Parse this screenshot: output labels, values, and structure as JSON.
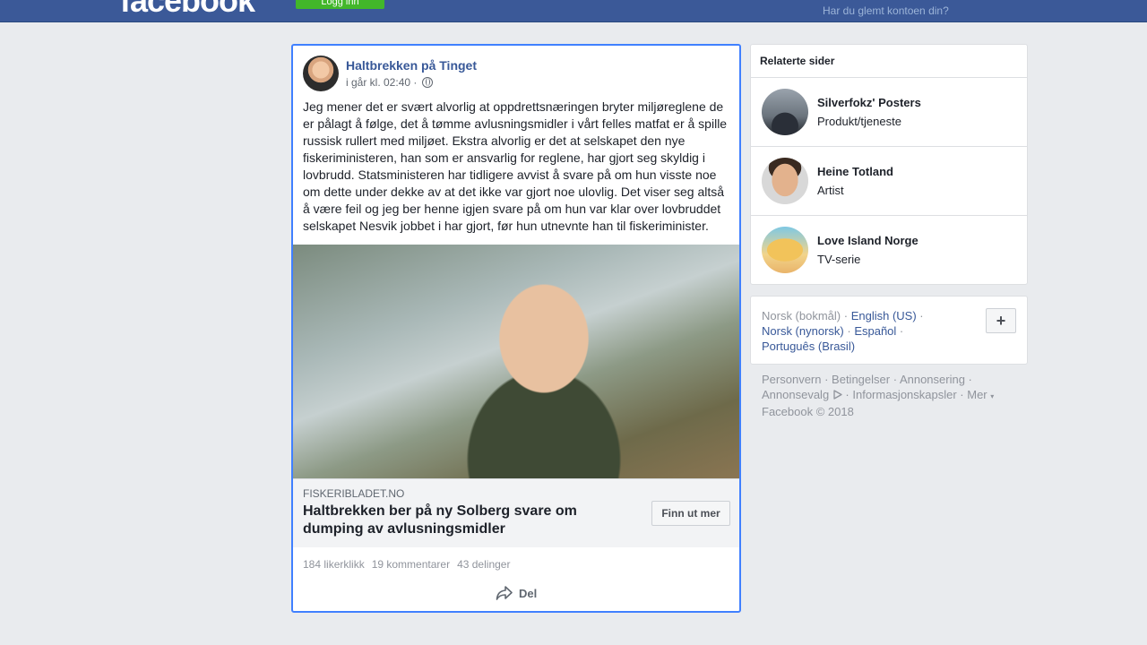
{
  "topbar": {
    "logo": "facebook",
    "green_button": "Logg inn",
    "forgot_link": "Har du glemt kontoen din?"
  },
  "post": {
    "page_name": "Haltbrekken på Tinget",
    "timestamp": "i går kl. 02:40 ·",
    "text": "Jeg mener det er svært alvorlig at oppdrettsnæringen bryter miljøreglene de er pålagt å følge, det å tømme avlusningsmidler i vårt felles matfat er å spille russisk rullert med miljøet. Ekstra alvorlig er det at selskapet den nye fiskeriministeren, han som er ansvarlig for reglene, har gjort seg skyldig i lovbrudd. Statsministeren har tidligere avvist å svare på om hun visste noe om dette under dekke av at det ikke var gjort noe ulovlig. Det viser seg altså å være feil og jeg ber henne igjen svare på om hun var klar over lovbruddet selskapet Nesvik jobbet i har gjort, før hun utnevnte han til fiskeriminister.",
    "link": {
      "domain": "FISKERIBLADET.NO",
      "title": "Haltbrekken ber på ny Solberg svare om dumping av avlusningsmidler",
      "cta": "Finn ut mer"
    },
    "stats": {
      "likes": "184 likerklikk",
      "comments": "19 kommentarer",
      "shares": "43 delinger"
    },
    "share_label": "Del"
  },
  "related": {
    "header": "Relaterte sider",
    "items": [
      {
        "name": "Silverfokz' Posters",
        "category": "Produkt/tjeneste"
      },
      {
        "name": "Heine Totland",
        "category": "Artist"
      },
      {
        "name": "Love Island Norge",
        "category": "TV-serie"
      }
    ]
  },
  "languages": {
    "current": "Norsk (bokmål) ·",
    "links": [
      "English (US)",
      "Norsk (nynorsk)",
      "Español",
      "Português (Brasil)"
    ],
    "plus": "+"
  },
  "footer": {
    "links": [
      "Personvern",
      "Betingelser",
      "Annonsering",
      "Annonsevalg",
      "Informasjonskapsler",
      "Mer"
    ],
    "copyright": "Facebook © 2018"
  }
}
